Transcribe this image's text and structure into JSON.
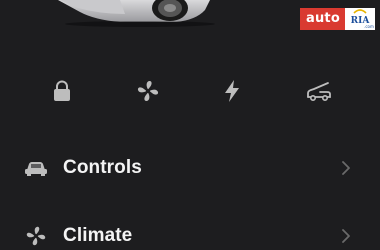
{
  "watermark": {
    "auto_text": "auto",
    "ria_text": "RIA",
    "ria_sub": ".com"
  },
  "colors": {
    "background": "#1d1d1f",
    "text": "#f4f4f4",
    "icon": "#bdbdbd",
    "chevron": "#6a6a6a",
    "watermark_red": "#d93a30",
    "watermark_blue": "#1d4f9c"
  },
  "quick_actions": [
    {
      "icon": "lock-icon"
    },
    {
      "icon": "fan-icon"
    },
    {
      "icon": "lightning-icon"
    },
    {
      "icon": "car-trunk-icon"
    }
  ],
  "menu": [
    {
      "label": "Controls",
      "icon": "car-icon"
    },
    {
      "label": "Climate",
      "icon": "fan-icon"
    }
  ]
}
